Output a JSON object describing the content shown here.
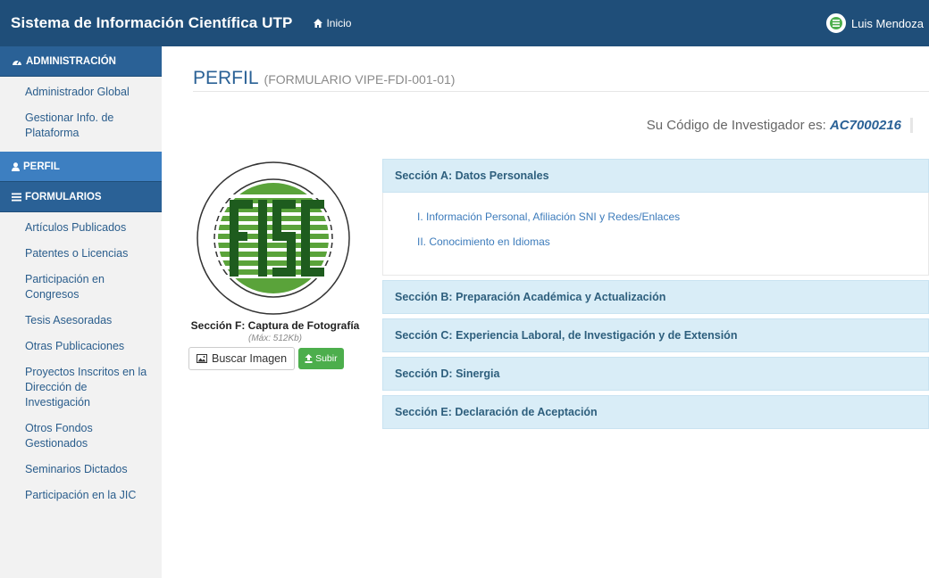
{
  "navbar": {
    "brand": "Sistema de Información Científica UTP",
    "home": "Inicio",
    "user_name": "Luis Mendoza"
  },
  "sidebar": {
    "admin_header": "ADMINISTRACIÓN",
    "admin_items": [
      "Administrador Global",
      "Gestionar Info. de Plataforma"
    ],
    "perfil_header": "PERFIL",
    "forms_header": "FORMULARIOS",
    "form_items": [
      "Artículos Publicados",
      "Patentes o Licencias",
      "Participación en Congresos",
      "Tesis Asesoradas",
      "Otras Publicaciones",
      "Proyectos Inscritos en la Dirección de Investigación",
      "Otros Fondos Gestionados",
      "Seminarios Dictados",
      "Participación en la JIC"
    ]
  },
  "main": {
    "title": "PERFIL",
    "subtitle": "(FORMULARIO VIPE-FDI-001-01)",
    "code_label": "Su Código de Investigador es:",
    "code_value": "AC7000216",
    "photo": {
      "caption": "Sección F: Captura de Fotografía",
      "note": "(Máx: 512Kb)",
      "browse_label": "Buscar Imagen",
      "upload_label": "Subir"
    },
    "sections": [
      {
        "label": "Sección A: Datos Personales",
        "links": [
          "I. Información Personal, Afiliación SNI y Redes/Enlaces",
          "II. Conocimiento en Idiomas"
        ]
      },
      {
        "label": "Sección B: Preparación Académica y Actualización"
      },
      {
        "label": "Sección C: Experiencia Laboral, de Investigación y de Extensión"
      },
      {
        "label": "Sección D: Sinergia"
      },
      {
        "label": "Sección E: Declaración de Aceptación"
      }
    ]
  },
  "colors": {
    "navbar": "#1f4e79",
    "sidebar_header": "#2a6196",
    "accordion_head": "#d9edf7",
    "success": "#4cae4c"
  }
}
